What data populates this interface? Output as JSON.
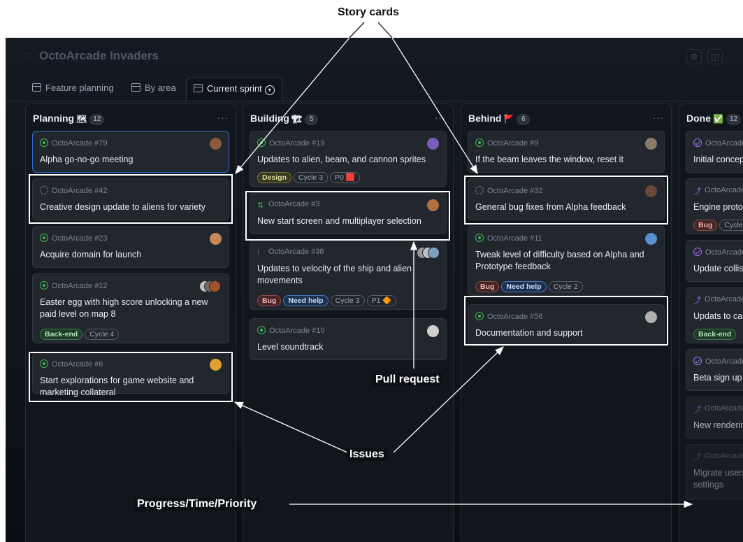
{
  "annotations": {
    "story_cards": "Story cards",
    "pull_request": "Pull request",
    "issues": "Issues",
    "progress": "Progress/Time/Priority"
  },
  "header": {
    "title": "OctoArcade Invaders",
    "logo_icon": "heart-icon",
    "settings_icon": "gear-icon",
    "panel_icon": "sidebar-icon"
  },
  "tabs": [
    {
      "label": "Feature planning",
      "icon": "table-icon"
    },
    {
      "label": "By area",
      "icon": "table-icon"
    },
    {
      "label": "Current sprint",
      "icon": "board-icon",
      "active": true
    }
  ],
  "columns": [
    {
      "name": "Planning",
      "emoji": "🗺",
      "count": "12",
      "cards": [
        {
          "id": "OctoArcade #79",
          "title": "Alpha go-no-go meeting",
          "status": "open",
          "avatar": "#8b5a3c",
          "selected": true,
          "labels": []
        },
        {
          "id": "OctoArcade #42",
          "title": "Creative design update to aliens for variety",
          "status": "draft",
          "avatar": "",
          "labels": []
        },
        {
          "id": "OctoArcade #23",
          "title": "Acquire domain for launch",
          "status": "open",
          "avatar": "#c9885a",
          "labels": []
        },
        {
          "id": "OctoArcade #12",
          "title": "Easter egg with high score unlocking a new paid level on map 8",
          "status": "open",
          "avatar": "#a0522d",
          "labels": [
            {
              "text": "Back-end",
              "style": "green"
            },
            {
              "text": "Cycle 4",
              "style": "plain"
            }
          ]
        },
        {
          "id": "OctoArcade #6",
          "title": "Start explorations for game website and marketing collateral",
          "status": "open",
          "avatar": "#e0a030",
          "labels": []
        }
      ]
    },
    {
      "name": "Building",
      "emoji": "🏗",
      "count": "5",
      "cards": [
        {
          "id": "OctoArcade #19",
          "title": "Updates to alien, beam, and cannon sprites",
          "status": "open",
          "avatar": "#7a5cb8",
          "labels": [
            {
              "text": "Design",
              "style": "olive"
            },
            {
              "text": "Cycle 3",
              "style": "plain"
            },
            {
              "text": "P0 🟥",
              "style": "plain"
            }
          ]
        },
        {
          "id": "OctoArcade #3",
          "title": "New start screen and multiplayer selection",
          "status": "pr",
          "avatar": "#b07040",
          "labels": []
        },
        {
          "id": "OctoArcade #38",
          "title": "Updates to velocity of the ship and alien movements",
          "status": "prdraft",
          "avatar": "#9a9a9a",
          "labels": [
            {
              "text": "Bug",
              "style": "red"
            },
            {
              "text": "Need help",
              "style": "blue"
            },
            {
              "text": "Cycle 3",
              "style": "plain"
            },
            {
              "text": "P1 🔶",
              "style": "plain"
            }
          ]
        },
        {
          "id": "OctoArcade #10",
          "title": "Level soundtrack",
          "status": "open",
          "avatar": "#d0d0d0",
          "labels": []
        }
      ]
    },
    {
      "name": "Behind",
      "emoji": "🚩",
      "count": "6",
      "cards": [
        {
          "id": "OctoArcade #9",
          "title": "If the beam leaves the window, reset it",
          "status": "open",
          "avatar": "#8a7a6a",
          "labels": []
        },
        {
          "id": "OctoArcade #32",
          "title": "General bug fixes from Alpha feedback",
          "status": "draft",
          "avatar": "#6a4a3a",
          "labels": []
        },
        {
          "id": "OctoArcade #11",
          "title": "Tweak level of difficulty based on Alpha and Prototype feedback",
          "status": "open",
          "avatar": "#5a8fd0",
          "labels": [
            {
              "text": "Bug",
              "style": "red"
            },
            {
              "text": "Need help",
              "style": "blue"
            },
            {
              "text": "Cycle 2",
              "style": "plain"
            }
          ]
        },
        {
          "id": "OctoArcade #56",
          "title": "Documentation and support",
          "status": "open",
          "avatar": "#b0b0b0",
          "labels": []
        }
      ]
    },
    {
      "name": "Done",
      "emoji": "✅",
      "count": "12",
      "cards": [
        {
          "id": "OctoArcade",
          "title": "Initial concep",
          "status": "done",
          "avatar": "",
          "labels": []
        },
        {
          "id": "OctoArcade",
          "title": "Engine protot",
          "status": "prmerged",
          "avatar": "",
          "labels": [
            {
              "text": "Bug",
              "style": "red"
            },
            {
              "text": "Cycle",
              "style": "plain"
            }
          ]
        },
        {
          "id": "OctoArcade",
          "title": "Update collisi",
          "status": "done",
          "avatar": "",
          "labels": []
        },
        {
          "id": "OctoArcade",
          "title": "Updats to car",
          "status": "prmerged",
          "avatar": "",
          "labels": [
            {
              "text": "Back-end",
              "style": "green"
            }
          ]
        },
        {
          "id": "OctoArcade",
          "title": "Beta sign up",
          "status": "done",
          "avatar": "",
          "labels": []
        },
        {
          "id": "OctoArcade",
          "title": "New renderin",
          "status": "prmerged",
          "avatar": "",
          "labels": []
        },
        {
          "id": "OctoArcade",
          "title": "Migrate users settings",
          "status": "prmerged",
          "avatar": "",
          "labels": []
        }
      ]
    }
  ]
}
